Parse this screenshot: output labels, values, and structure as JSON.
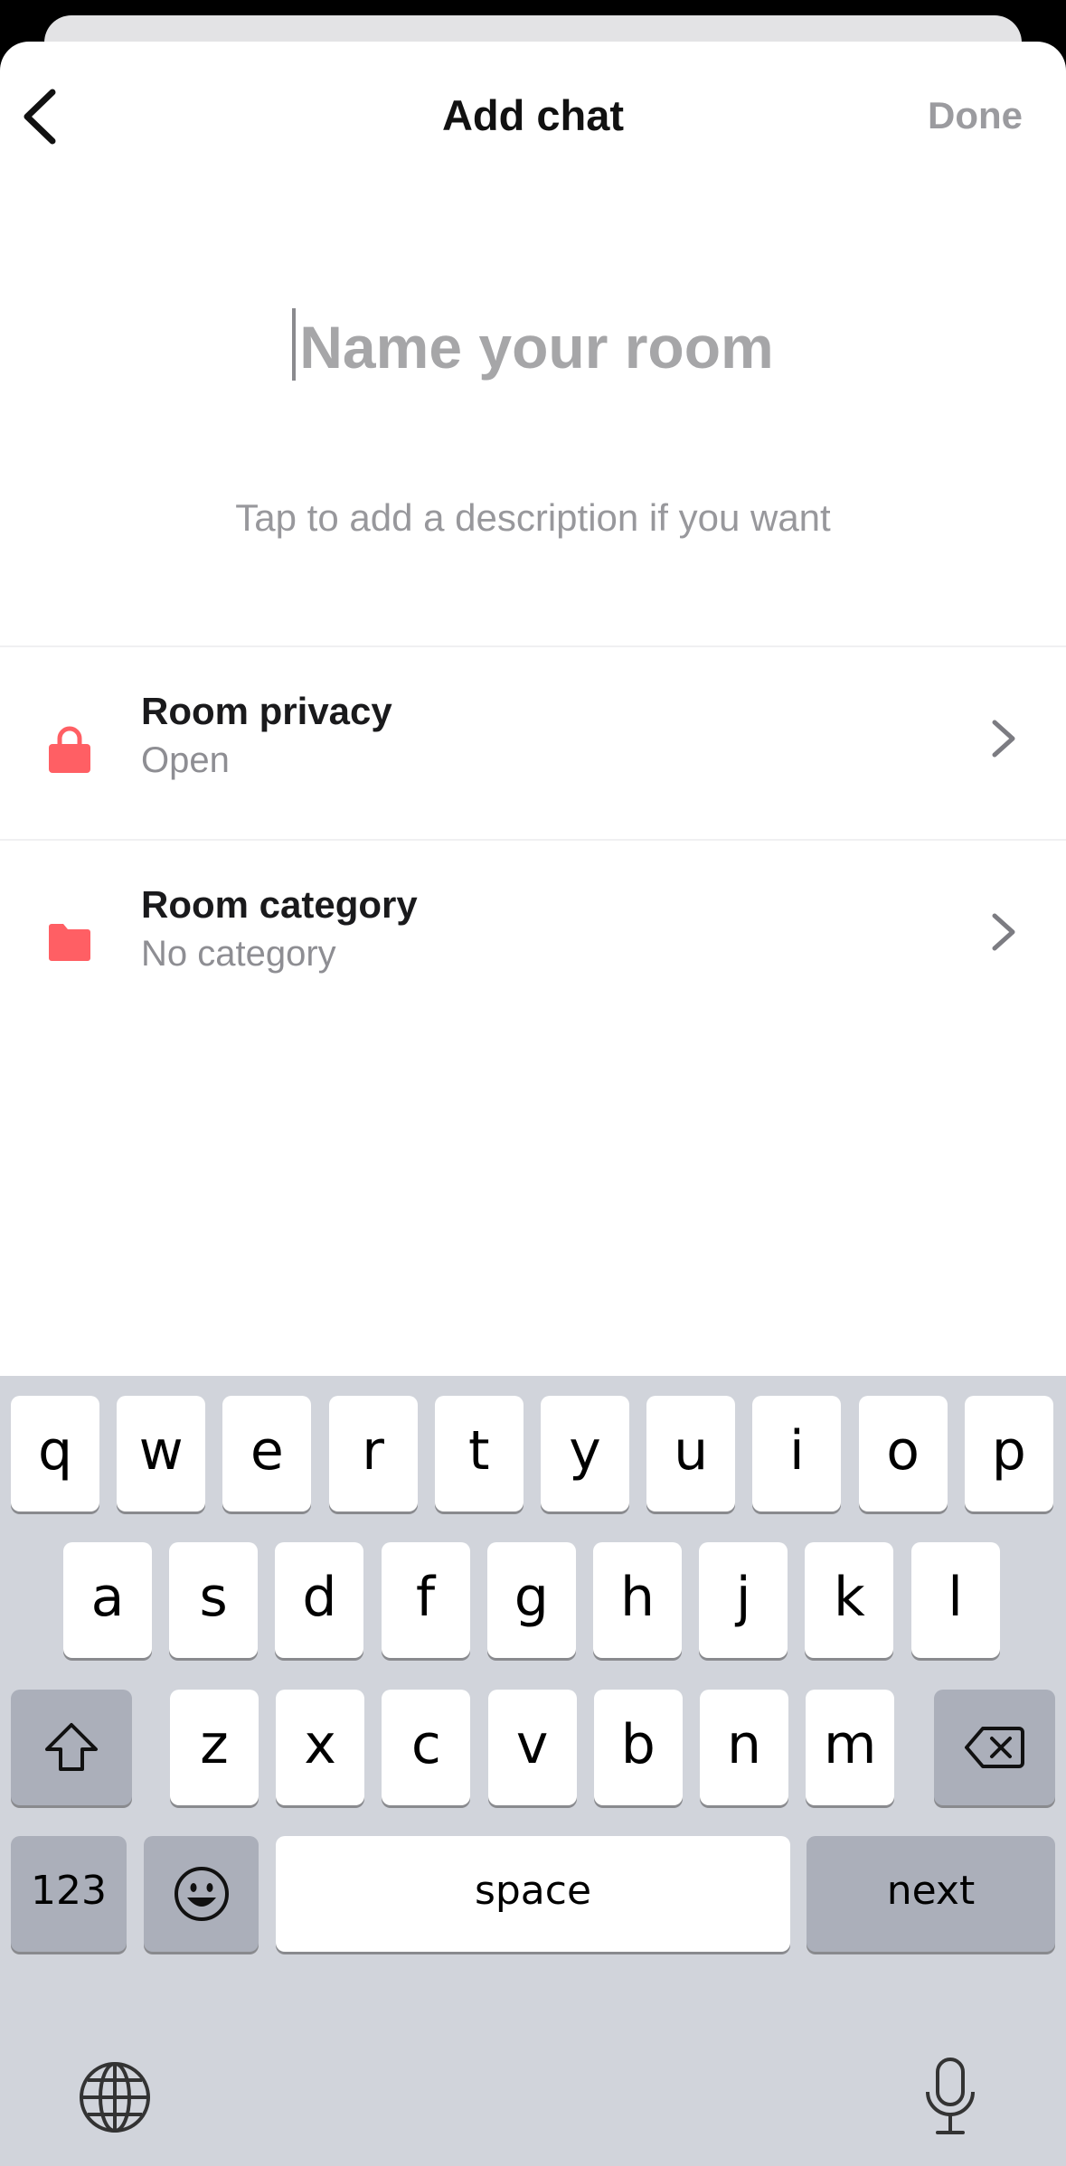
{
  "header": {
    "title": "Add chat",
    "done_label": "Done"
  },
  "room": {
    "name_placeholder": "Name your room",
    "description_placeholder": "Tap to add a description if you want"
  },
  "settings": [
    {
      "title": "Room privacy",
      "value": "Open",
      "icon": "lock-icon"
    },
    {
      "title": "Room category",
      "value": "No category",
      "icon": "folder-icon"
    }
  ],
  "keyboard": {
    "row1": [
      "q",
      "w",
      "e",
      "r",
      "t",
      "y",
      "u",
      "i",
      "o",
      "p"
    ],
    "row2": [
      "a",
      "s",
      "d",
      "f",
      "g",
      "h",
      "j",
      "k",
      "l"
    ],
    "row3": [
      "z",
      "x",
      "c",
      "v",
      "b",
      "n",
      "m"
    ],
    "numbers_label": "123",
    "space_label": "space",
    "return_label": "next"
  },
  "colors": {
    "accent": "#ff5f64",
    "done_disabled": "#9b9b9f",
    "keyboard_bg": "#d1d4db"
  }
}
